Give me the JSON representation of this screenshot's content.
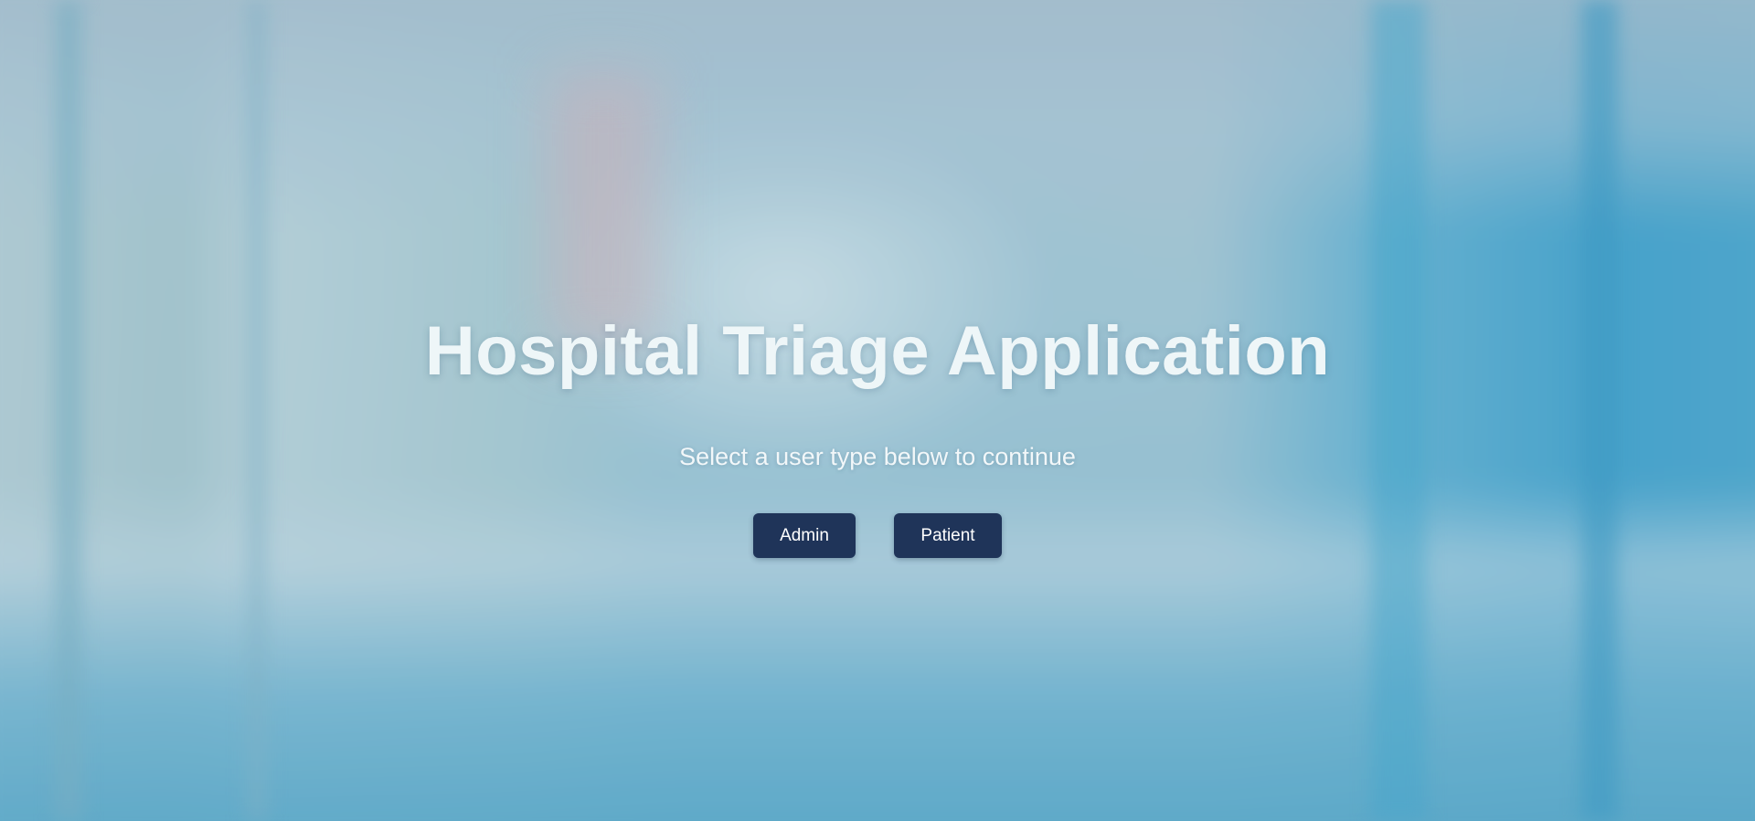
{
  "app": {
    "title": "Hospital Triage Application",
    "subtitle": "Select a user type below to continue"
  },
  "buttons": {
    "admin_label": "Admin",
    "patient_label": "Patient"
  },
  "colors": {
    "button_bg": "#1f3459",
    "button_text": "#ffffff",
    "title_text": "#eef6f8"
  }
}
